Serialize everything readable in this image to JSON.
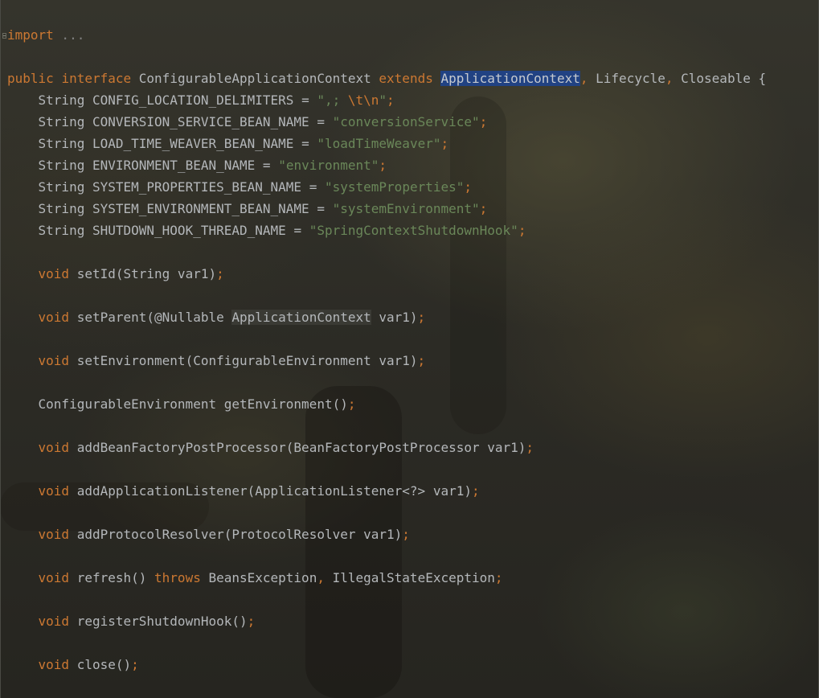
{
  "editor": {
    "folded_import": {
      "keyword": "import",
      "ellipsis": " ..."
    },
    "decl": {
      "kw1": "public",
      "kw2": "interface",
      "name": "ConfigurableApplicationContext",
      "kw3": "extends",
      "selected": "ApplicationContext",
      "comma1": ",",
      "t2": "Lifecycle",
      "comma2": ",",
      "t3": "Closeable",
      "brace": "{"
    },
    "constants": [
      {
        "type": "String",
        "name": "CONFIG_LOCATION_DELIMITERS",
        "eq": "=",
        "q1": "\",; ",
        "esc": "\\t\\n",
        "q2": "\"",
        "semi": ";"
      },
      {
        "type": "String",
        "name": "CONVERSION_SERVICE_BEAN_NAME",
        "eq": "=",
        "value": "\"conversionService\"",
        "semi": ";"
      },
      {
        "type": "String",
        "name": "LOAD_TIME_WEAVER_BEAN_NAME",
        "eq": "=",
        "value": "\"loadTimeWeaver\"",
        "semi": ";"
      },
      {
        "type": "String",
        "name": "ENVIRONMENT_BEAN_NAME",
        "eq": "=",
        "value": "\"environment\"",
        "semi": ";"
      },
      {
        "type": "String",
        "name": "SYSTEM_PROPERTIES_BEAN_NAME",
        "eq": "=",
        "value": "\"systemProperties\"",
        "semi": ";"
      },
      {
        "type": "String",
        "name": "SYSTEM_ENVIRONMENT_BEAN_NAME",
        "eq": "=",
        "value": "\"systemEnvironment\"",
        "semi": ";"
      },
      {
        "type": "String",
        "name": "SHUTDOWN_HOOK_THREAD_NAME",
        "eq": "=",
        "value": "\"SpringContextShutdownHook\"",
        "semi": ";"
      }
    ],
    "methods": {
      "m1": {
        "kw": "void",
        "sig": "setId(String var1)",
        "semi": ";"
      },
      "m2": {
        "kw": "void",
        "pre": "setParent(@Nullable ",
        "ref": "ApplicationContext",
        "post": " var1)",
        "semi": ";"
      },
      "m3": {
        "kw": "void",
        "sig": "setEnvironment(ConfigurableEnvironment var1)",
        "semi": ";"
      },
      "m4": {
        "sig": "ConfigurableEnvironment getEnvironment()",
        "semi": ";"
      },
      "m5": {
        "kw": "void",
        "sig": "addBeanFactoryPostProcessor(BeanFactoryPostProcessor var1)",
        "semi": ";"
      },
      "m6": {
        "kw": "void",
        "sig": "addApplicationListener(ApplicationListener<?> var1)",
        "semi": ";"
      },
      "m7": {
        "kw": "void",
        "sig": "addProtocolResolver(ProtocolResolver var1)",
        "semi": ";"
      },
      "m8": {
        "kw": "void",
        "sig": "refresh() ",
        "kw2": "throws",
        "t1": " BeansException",
        "comma": ",",
        "t2": " IllegalStateException",
        "semi": ";"
      },
      "m9": {
        "kw": "void",
        "sig": "registerShutdownHook()",
        "semi": ";"
      },
      "m10": {
        "kw": "void",
        "sig": "close()",
        "semi": ";"
      }
    }
  }
}
